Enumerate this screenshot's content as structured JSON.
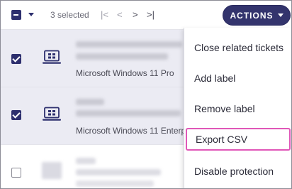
{
  "toolbar": {
    "selected_text": "3 selected",
    "pager": {
      "first": "|<",
      "prev": "<",
      "next": ">",
      "last": ">|"
    },
    "actions_label": "ACTIONS"
  },
  "rows": [
    {
      "checked": true,
      "os": "Microsoft Windows 11 Pro"
    },
    {
      "checked": true,
      "os": "Microsoft Windows 11 Enterp"
    },
    {
      "checked": false,
      "os": ""
    }
  ],
  "menu": {
    "items": [
      {
        "label": "Close related tickets"
      },
      {
        "label": "Add label"
      },
      {
        "label": "Remove label"
      },
      {
        "label": "Export CSV",
        "highlighted": true
      },
      {
        "label": "Disable protection"
      }
    ]
  },
  "colors": {
    "accent": "#33346d",
    "selected_row_bg": "#ebebf3",
    "highlight_outline": "#e057b8"
  }
}
